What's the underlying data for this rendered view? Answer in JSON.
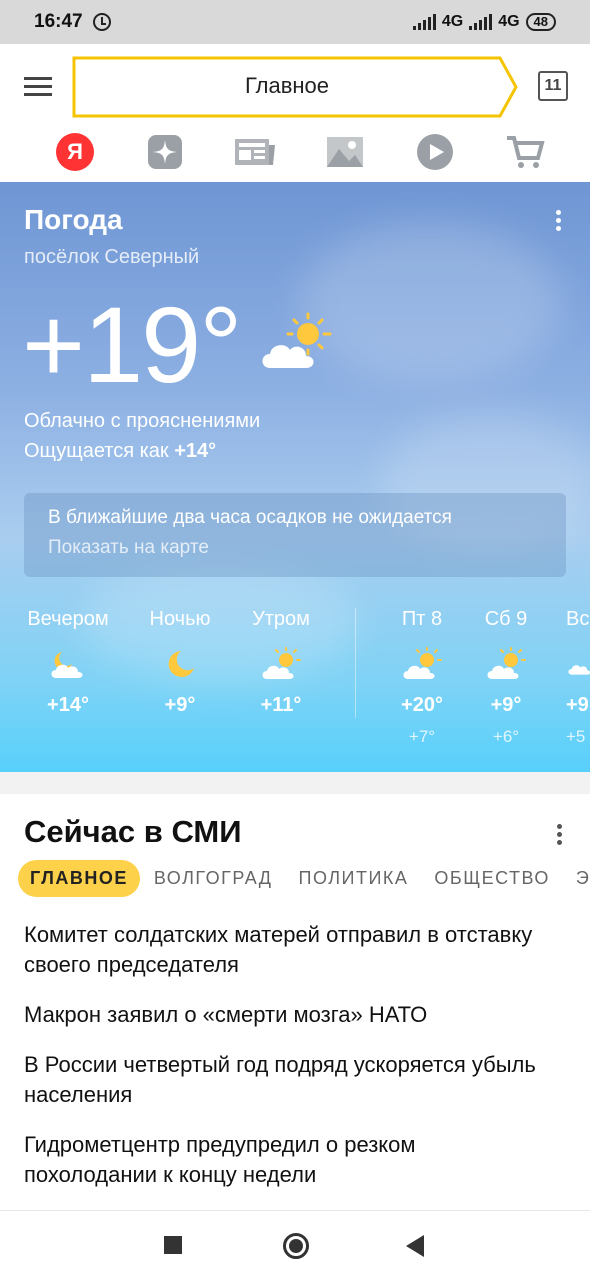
{
  "status_bar": {
    "time": "16:47",
    "net1": "4G",
    "net2": "4G",
    "battery": "48"
  },
  "header": {
    "search_text": "Главное",
    "tabs_count": "11"
  },
  "services": [
    {
      "name": "yandex-logo",
      "label": "Я"
    },
    {
      "name": "zen-icon"
    },
    {
      "name": "news-icon"
    },
    {
      "name": "images-icon"
    },
    {
      "name": "video-icon"
    },
    {
      "name": "market-cart-icon"
    }
  ],
  "weather": {
    "title": "Погода",
    "location": "посёлок Северный",
    "temperature": "+19°",
    "condition": "Облачно с прояснениями",
    "feels_like_label": "Ощущается как",
    "feels_like_value": "+14°",
    "precip_text": "В ближайшие два часа осадков не ожидается",
    "map_link": "Показать на карте",
    "forecast": [
      {
        "label": "Вечером",
        "icon": "moon-cloud-icon",
        "temp": "+14°",
        "low": ""
      },
      {
        "label": "Ночью",
        "icon": "moon-icon",
        "temp": "+9°",
        "low": ""
      },
      {
        "label": "Утром",
        "icon": "sun-cloud-icon",
        "temp": "+11°",
        "low": ""
      },
      {
        "label": "Пт 8",
        "icon": "sun-cloud-icon",
        "temp": "+20°",
        "low": "+7°"
      },
      {
        "label": "Сб 9",
        "icon": "sun-cloud-icon",
        "temp": "+9°",
        "low": "+6°"
      },
      {
        "label": "Вс",
        "icon": "cloud-icon",
        "temp": "+9",
        "low": "+5"
      }
    ]
  },
  "news": {
    "title": "Сейчас в СМИ",
    "tabs": [
      "ГЛАВНОЕ",
      "ВОЛГОГРАД",
      "ПОЛИТИКА",
      "ОБЩЕСТВО",
      "ЭКО"
    ],
    "items": [
      "Комитет солдатских матерей отправил в отставку своего председателя",
      "Макрон заявил о «смерти мозга» НАТО",
      "В России четвертый год подряд ускоряется убыль населения",
      "Гидрометцентр предупредил о резком похолодании к концу недели"
    ]
  },
  "colors": {
    "accent_yellow": "#fdd24a",
    "search_border": "#f5c400",
    "yandex_red": "#ff3333"
  }
}
